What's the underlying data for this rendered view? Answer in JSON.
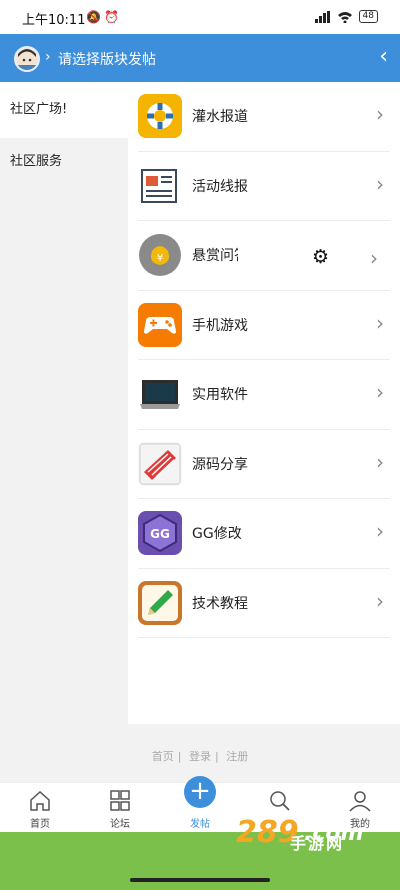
{
  "status": {
    "time": "上午10:11",
    "battery": "48"
  },
  "header": {
    "title": "请选择版块发帖"
  },
  "sidebar": {
    "items": [
      {
        "label": "社区广场!"
      },
      {
        "label": "社区服务"
      }
    ]
  },
  "list": {
    "items": [
      {
        "label": "灌水报道",
        "icon": "lifebuoy-icon"
      },
      {
        "label": "活动线报",
        "icon": "newspaper-icon"
      },
      {
        "label": "悬赏问答",
        "icon": "money-bag-icon"
      },
      {
        "label": "手机游戏",
        "icon": "gamepad-icon"
      },
      {
        "label": "实用软件",
        "icon": "laptop-icon"
      },
      {
        "label": "源码分享",
        "icon": "code-share-icon"
      },
      {
        "label": "GG修改",
        "icon": "gg-icon"
      },
      {
        "label": "技术教程",
        "icon": "pencil-icon"
      }
    ]
  },
  "footer": {
    "links": [
      "首页",
      "登录",
      "注册"
    ]
  },
  "nav": {
    "items": [
      {
        "label": "首页"
      },
      {
        "label": "论坛"
      },
      {
        "label": "发帖"
      },
      {
        "label": ""
      },
      {
        "label": "我的"
      }
    ]
  },
  "watermark": {
    "text": "手游网"
  }
}
